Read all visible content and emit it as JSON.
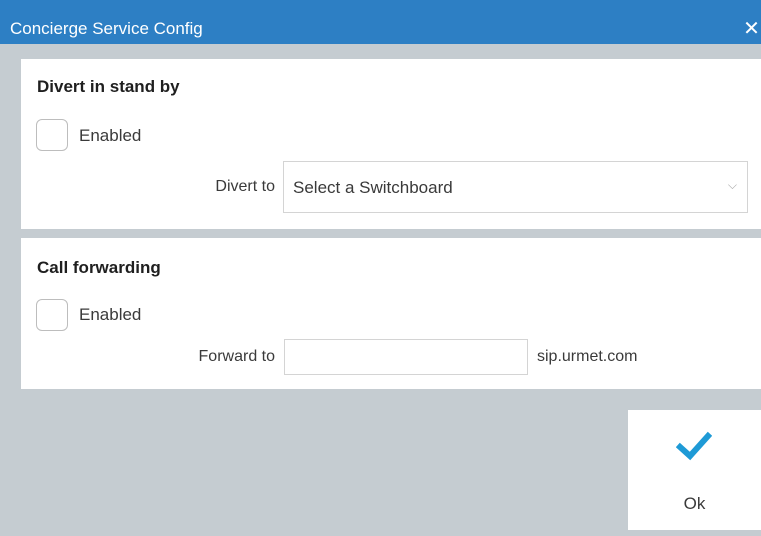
{
  "window": {
    "title": "Concierge Service Config",
    "close_glyph": "✕"
  },
  "divert": {
    "section_title": "Divert in stand by",
    "enabled_label": "Enabled",
    "enabled_checked": false,
    "target_label": "Divert to",
    "select_value": "Select a Switchboard",
    "select_arrow": "⌵"
  },
  "forwarding": {
    "section_title": "Call forwarding",
    "enabled_label": "Enabled",
    "enabled_checked": false,
    "target_label": "Forward to",
    "input_value": "",
    "domain": "sip.urmet.com"
  },
  "actions": {
    "ok_label": "Ok",
    "ok_icon": "checkmark-icon",
    "ok_icon_color": "#1e9ad6"
  },
  "colors": {
    "titlebar": "#2d7fc4",
    "background": "#c5ccd1",
    "panel": "#ffffff"
  }
}
